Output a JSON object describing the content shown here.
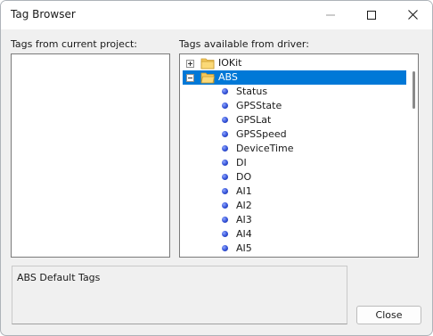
{
  "window": {
    "title": "Tag Browser"
  },
  "left_panel": {
    "label": "Tags from current project:"
  },
  "right_panel": {
    "label": "Tags available from driver:",
    "tree": [
      {
        "label": "IOKit",
        "type": "folder",
        "expander": "plus",
        "selected": false
      },
      {
        "label": "ABS",
        "type": "folder",
        "expander": "minus",
        "selected": true
      },
      {
        "label": "Status",
        "type": "tag"
      },
      {
        "label": "GPSState",
        "type": "tag"
      },
      {
        "label": "GPSLat",
        "type": "tag"
      },
      {
        "label": "GPSSpeed",
        "type": "tag"
      },
      {
        "label": "DeviceTime",
        "type": "tag"
      },
      {
        "label": "DI",
        "type": "tag"
      },
      {
        "label": "DO",
        "type": "tag"
      },
      {
        "label": "AI1",
        "type": "tag"
      },
      {
        "label": "AI2",
        "type": "tag"
      },
      {
        "label": "AI3",
        "type": "tag"
      },
      {
        "label": "AI4",
        "type": "tag"
      },
      {
        "label": "AI5",
        "type": "tag"
      }
    ]
  },
  "description": {
    "text": "ABS Default Tags"
  },
  "buttons": {
    "close_label": "Close"
  },
  "colors": {
    "selection": "#0078d7",
    "tag_icon": "#3250d6",
    "folder": "#f5c85c"
  },
  "icons": {
    "folder": "folder-icon",
    "tag": "tag-dot-icon",
    "expand": "plus-box-icon",
    "collapse": "minus-box-icon"
  }
}
